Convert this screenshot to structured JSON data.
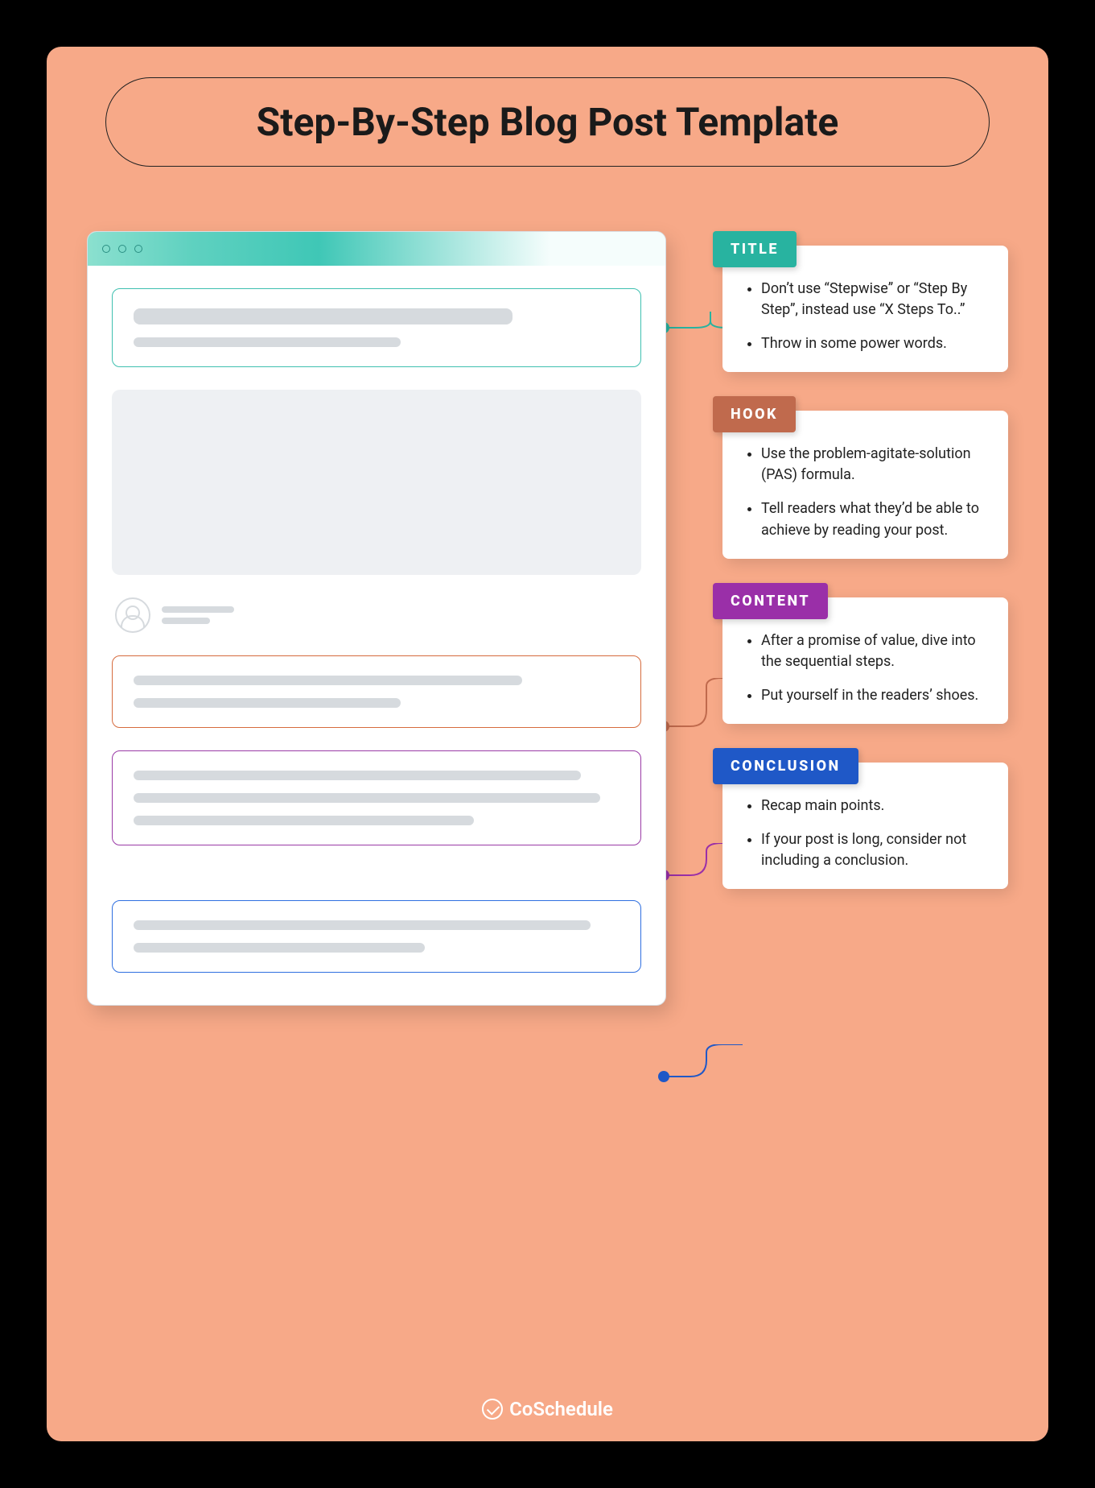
{
  "heading": "Step-By-Step Blog Post Template",
  "brand": "CoSchedule",
  "colors": {
    "teal": "#28b3a0",
    "rust": "#c06a4d",
    "purple": "#9a2fa8",
    "blue": "#1f58c7",
    "peach": "#f7a988"
  },
  "cards": [
    {
      "label": "TITLE",
      "color": "teal",
      "items": [
        "Don’t use “Stepwise” or “Step By Step”, instead use “X Steps To..”",
        "Throw in some power words."
      ]
    },
    {
      "label": "HOOK",
      "color": "rust",
      "items": [
        "Use the problem-agitate-solution (PAS) formula.",
        "Tell readers what they’d be able to achieve by reading your post."
      ]
    },
    {
      "label": "CONTENT",
      "color": "purple",
      "items": [
        "After a promise of value, dive into the sequential steps.",
        "Put yourself in the readers’ shoes."
      ]
    },
    {
      "label": "CONCLUSION",
      "color": "blue",
      "items": [
        "Recap main points.",
        "If your post is long, consider not including a conclusion."
      ]
    }
  ]
}
